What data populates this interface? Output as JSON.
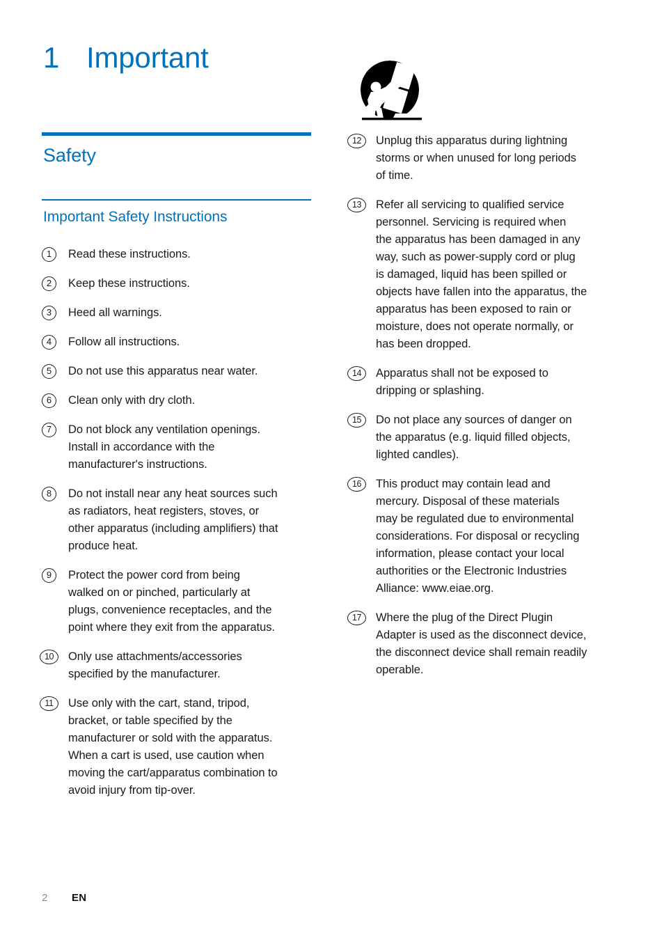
{
  "chapter": {
    "number": "1",
    "title": "Important"
  },
  "sections": {
    "safety": "Safety",
    "important_safety_instructions": "Important Safety Instructions"
  },
  "icons": {
    "cart_warning": "cart-tip-over-warning-icon"
  },
  "colors": {
    "heading_blue": "#0072bc",
    "body_text": "#1a1a1a",
    "page_number_gray": "#8c8c8c"
  },
  "instructions_left": [
    {
      "number": "1",
      "lines": [
        "Read these instructions."
      ]
    },
    {
      "number": "2",
      "lines": [
        "Keep these instructions."
      ]
    },
    {
      "number": "3",
      "lines": [
        "Heed all warnings."
      ]
    },
    {
      "number": "4",
      "lines": [
        "Follow all instructions."
      ]
    },
    {
      "number": "5",
      "lines": [
        "Do not use this apparatus near water."
      ]
    },
    {
      "number": "6",
      "lines": [
        "Clean only with dry cloth."
      ]
    },
    {
      "number": "7",
      "lines": [
        "Do not block any ventilation openings.",
        "Install in accordance with the",
        "manufacturer's instructions."
      ]
    },
    {
      "number": "8",
      "lines": [
        "Do not install near any heat sources such",
        "as radiators, heat registers, stoves, or",
        "other apparatus (including amplifiers) that",
        "produce heat."
      ]
    },
    {
      "number": "9",
      "lines": [
        "Protect the power cord from being",
        "walked on or pinched, particularly at",
        "plugs, convenience receptacles, and the",
        "point where they exit from the apparatus."
      ]
    },
    {
      "number": "10",
      "lines": [
        "Only use attachments/accessories",
        "specified by the manufacturer."
      ]
    },
    {
      "number": "11",
      "lines": [
        "Use only with the cart, stand, tripod,",
        "bracket, or table specified by the",
        "manufacturer or sold with the apparatus.",
        "When a cart is used, use caution when",
        "moving the cart/apparatus combination to",
        "avoid injury from tip-over."
      ]
    }
  ],
  "instructions_right": [
    {
      "number": "12",
      "lines": [
        "Unplug this apparatus during lightning",
        "storms or when unused for long periods",
        "of time."
      ]
    },
    {
      "number": "13",
      "lines": [
        "Refer all servicing to qualified service",
        "personnel. Servicing is required when",
        "the apparatus has been damaged in any",
        "way, such as power-supply cord or plug",
        "is damaged, liquid has been spilled or",
        "objects have fallen into the apparatus, the",
        "apparatus has been exposed to rain or",
        "moisture, does not operate normally, or",
        "has been dropped."
      ]
    },
    {
      "number": "14",
      "lines": [
        "Apparatus shall not be exposed to",
        "dripping or splashing."
      ]
    },
    {
      "number": "15",
      "lines": [
        "Do not place any sources of danger on",
        "the apparatus (e.g. liquid filled objects,",
        "lighted candles)."
      ]
    },
    {
      "number": "16",
      "lines": [
        "This product may contain lead and",
        "mercury. Disposal of these materials",
        "may be regulated due to environmental",
        "considerations. For disposal or recycling",
        "information, please contact your local",
        "authorities or the Electronic Industries",
        "Alliance: www.eiae.org."
      ]
    },
    {
      "number": "17",
      "lines": [
        "Where the plug of the Direct Plugin",
        "Adapter is used as the disconnect device,",
        "the disconnect device shall remain readily",
        "operable."
      ]
    }
  ],
  "footer": {
    "page_number": "2",
    "language": "EN"
  }
}
